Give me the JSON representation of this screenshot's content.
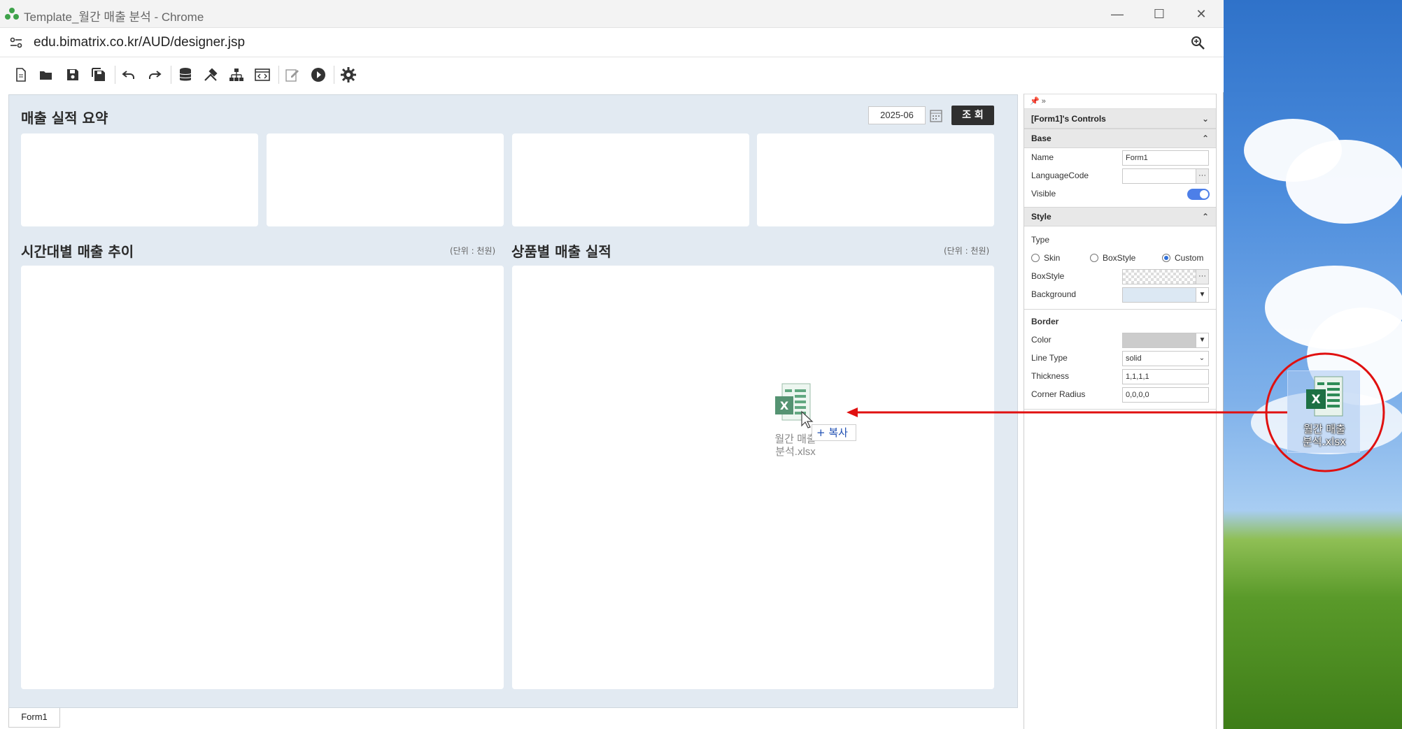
{
  "window": {
    "title": "Template_월간 매출 분석 - Chrome",
    "url": "edu.bimatrix.co.kr/AUD/designer.jsp"
  },
  "dashboard": {
    "summary_title": "매출 실적 요약",
    "date_value": "2025-06",
    "query_button": "조 회",
    "trend_title": "시간대별 매출 추이",
    "trend_unit": "(단위 : 천원)",
    "product_title": "상품별 매출 실적",
    "product_unit": "(단위 : 천원)"
  },
  "bottom_tab": "Form1",
  "properties": {
    "pin_label": "📌 »",
    "controls_header": "[Form1]'s Controls",
    "base_header": "Base",
    "name_label": "Name",
    "name_value": "Form1",
    "language_label": "LanguageCode",
    "language_value": "",
    "visible_label": "Visible",
    "visible_on": true,
    "style_header": "Style",
    "type_label": "Type",
    "type_options": [
      "Skin",
      "BoxStyle",
      "Custom"
    ],
    "type_selected": "Custom",
    "boxstyle_label": "BoxStyle",
    "background_label": "Background",
    "background_color": "#dce8f3",
    "border_header": "Border",
    "color_label": "Color",
    "border_color": "#cccccc",
    "linetype_label": "Line Type",
    "linetype_value": "solid",
    "thickness_label": "Thickness",
    "thickness_value": "1,1,1,1",
    "radius_label": "Corner Radius",
    "radius_value": "0,0,0,0"
  },
  "drag": {
    "file_name_line1": "월간 매출",
    "file_name_line2": "분석.xlsx",
    "drag_label_line1": "월간 매출",
    "drag_label_line2": "분석.xlsx",
    "copy_label": "+ 복사"
  },
  "colors": {
    "annotation_red": "#e01010",
    "excel_green": "#1d7044",
    "accent_blue": "#4d7fe8"
  }
}
